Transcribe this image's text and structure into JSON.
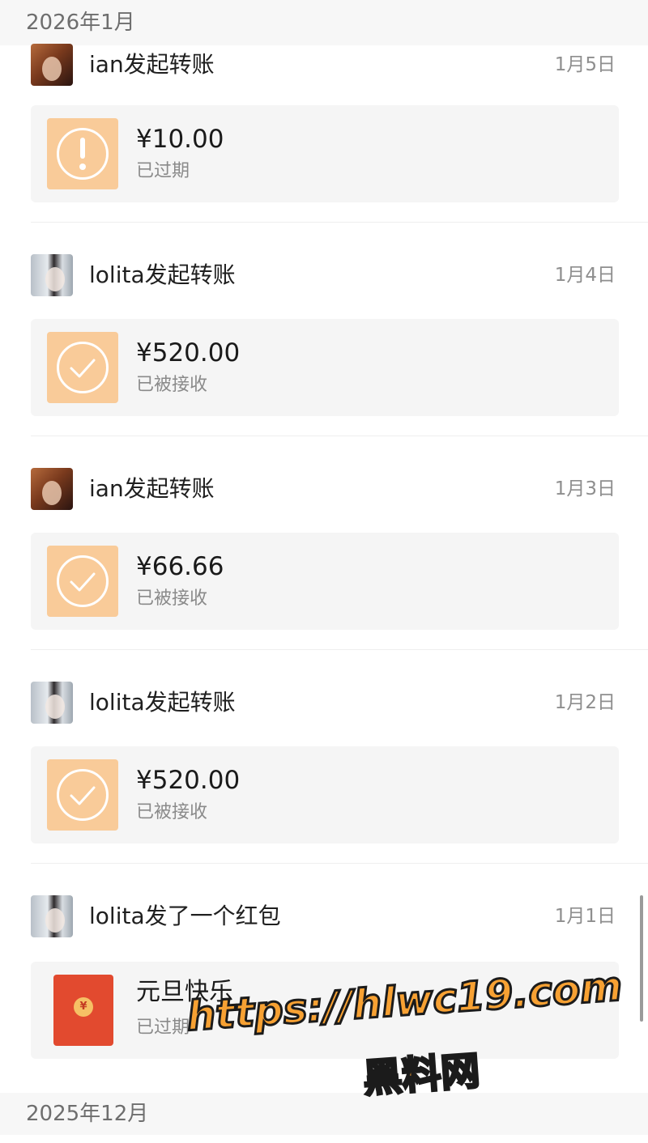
{
  "months": [
    "2026年1月",
    "2025年12月"
  ],
  "entries": [
    {
      "user": "ian",
      "title": "ian发起转账",
      "date": "1月5日",
      "amount": "¥10.00",
      "status": "已过期",
      "icon": "exclamation-icon"
    },
    {
      "user": "lolita",
      "title": "lolita发起转账",
      "date": "1月4日",
      "amount": "¥520.00",
      "status": "已被接收",
      "icon": "check-icon"
    },
    {
      "user": "ian",
      "title": "ian发起转账",
      "date": "1月3日",
      "amount": "¥66.66",
      "status": "已被接收",
      "icon": "check-icon"
    },
    {
      "user": "lolita",
      "title": "lolita发起转账",
      "date": "1月2日",
      "amount": "¥520.00",
      "status": "已被接收",
      "icon": "check-icon"
    },
    {
      "user": "lolita",
      "title": "lolita发了一个红包",
      "date": "1月1日",
      "amount": "元旦快乐",
      "status": "已过期",
      "icon": "red-envelope-icon"
    }
  ],
  "red_envelope_coin": "¥",
  "watermark": {
    "url": "https://hlwc19.com",
    "name": "黑料网"
  },
  "colors": {
    "badge": "#f9cb99",
    "envelope": "#e24a2f",
    "watermark": "#f7a133"
  }
}
